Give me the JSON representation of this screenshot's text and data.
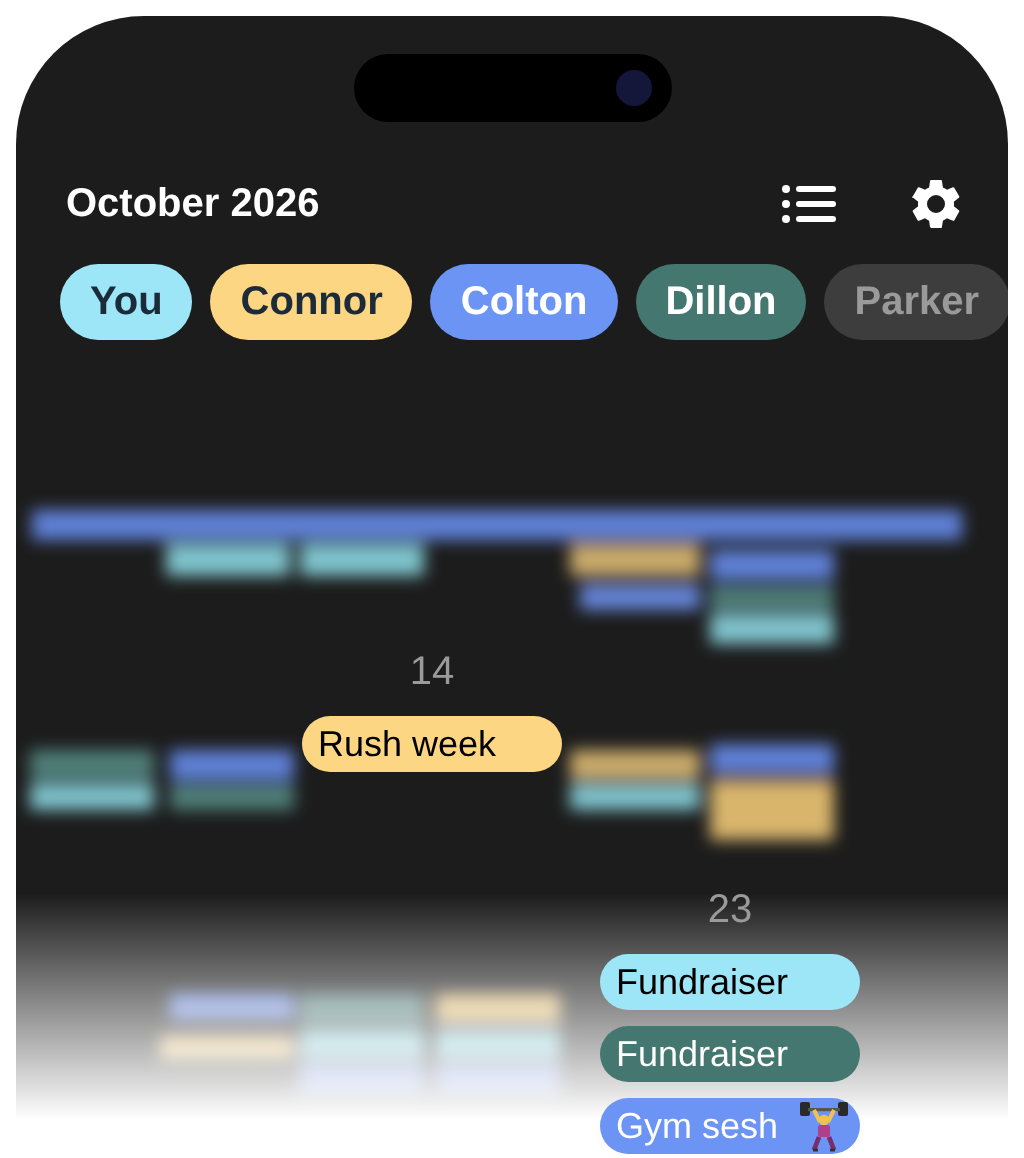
{
  "header": {
    "title": "October 2026"
  },
  "people": [
    {
      "name": "You",
      "color": "#9de6f7"
    },
    {
      "name": "Connor",
      "color": "#fdd684"
    },
    {
      "name": "Colton",
      "color": "#6b94f5"
    },
    {
      "name": "Dillon",
      "color": "#44776f"
    },
    {
      "name": "Parker",
      "color": "#3d3d3d"
    }
  ],
  "callouts": [
    {
      "day": "14",
      "events": [
        {
          "title": "Rush week",
          "color": "#fdd684"
        }
      ]
    },
    {
      "day": "23",
      "events": [
        {
          "title": "Fundraiser",
          "color": "#9de6f7"
        },
        {
          "title": "Fundraiser",
          "color": "#44776f"
        },
        {
          "title": "Gym sesh",
          "color": "#6b94f5",
          "kind": "gym"
        }
      ]
    }
  ]
}
